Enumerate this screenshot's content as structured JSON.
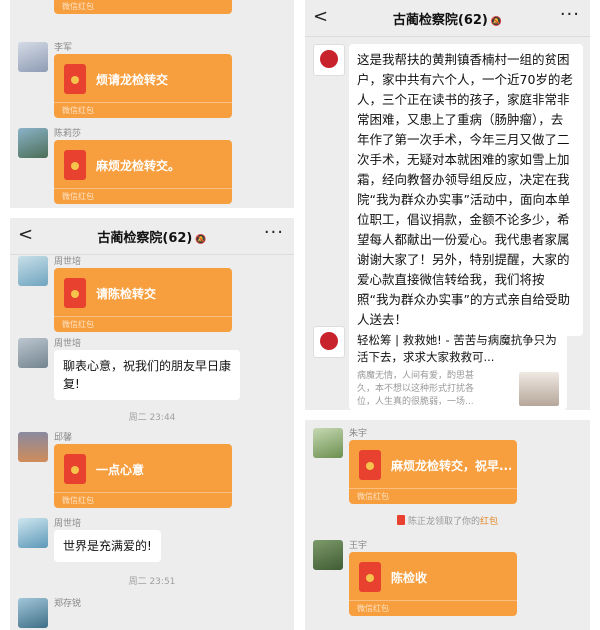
{
  "panel1": {
    "top_footer": "微信红包",
    "messages": [
      {
        "sender": "李军",
        "envelope": "烦请龙检转交",
        "footer": "微信红包"
      },
      {
        "sender": "陈莉莎",
        "envelope": "麻烦龙检转交。",
        "footer": "微信红包"
      }
    ]
  },
  "panel2": {
    "header": {
      "title": "古蔺检察院(62)",
      "back": "<",
      "more": "···"
    },
    "msg1": {
      "sender": "周世培",
      "envelope": "请陈检转交",
      "footer": "微信红包"
    },
    "msg2": {
      "sender": "周世培",
      "text": "聊表心意，祝我们的朋友早日康复!"
    },
    "time1": "周二 23:44",
    "msg3": {
      "sender": "邱馨",
      "envelope": "一点心意",
      "footer": "微信红包"
    },
    "msg4": {
      "sender": "周世培",
      "text": "世界是充满爱的!"
    },
    "time2": "周二 23:51",
    "msg5": {
      "sender": "郑存锐"
    }
  },
  "panel3": {
    "header": {
      "title": "古蔺检察院(62)",
      "back": "<",
      "more": "···"
    },
    "long_text": "这是我帮扶的黄荆镇香楠村一组的贫困户，家中共有六个人，一个近70岁的老人，三个正在读书的孩子，家庭非常非常困难，又患上了重病（肠肿瘤），去年作了第一次手术，今年三月又做了二次手术，无疑对本就困难的家如雪上加霜，经向教督办领导组反应，决定在我院“我为群众办实事”活动中，面向本单位职工，倡议捐款，金额不论多少，希望每人都献出一份爱心。我代患者家属谢谢大家了！另外，特别提醒，大家的爱心款直接微信转给我，我们将按照“我为群众办实事”的方式亲自给受助人送去！",
    "card": {
      "title": "轻松筹 | 救救她! - 苦苦与病魔抗争只为活下去，求求大家救救可...",
      "desc": "病魔无情，人间有爱，酌思甚久，本不想以这种形式打扰各位，人生真的很脆弱，一场..."
    }
  },
  "panel4": {
    "msg1": {
      "sender": "朱宇",
      "envelope": "麻烦龙检转交，祝早...",
      "footer": "微信红包"
    },
    "notice": {
      "prefix": "陈正龙领取了你的",
      "link": "红包"
    },
    "msg2": {
      "sender": "王宇",
      "envelope": "陈检收",
      "footer": "微信红包"
    }
  },
  "colors": {
    "envelope": "#f79f3f",
    "envelope_icon": "#e8412f",
    "chat_bg": "#ededed",
    "bubble": "#ffffff"
  }
}
